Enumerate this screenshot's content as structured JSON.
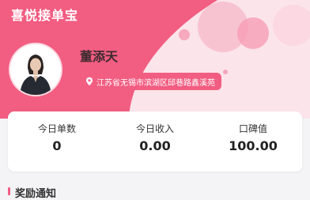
{
  "app": {
    "title": "喜悦接单宝"
  },
  "profile": {
    "name": "董添天",
    "address": "江苏省无锡市滨湖区邱巷路鑫溪苑",
    "address_icon": "location-pin-icon",
    "avatar": "avatar-photo"
  },
  "stats": [
    {
      "label": "今日单数",
      "value": "0"
    },
    {
      "label": "今日收入",
      "value": "0.00"
    },
    {
      "label": "口碑值",
      "value": "100.00"
    }
  ],
  "section": {
    "title": "奖励通知"
  },
  "colors": {
    "accent": "#f25d82",
    "header_light": "#fbe4ea",
    "background": "#f4f4f6"
  }
}
